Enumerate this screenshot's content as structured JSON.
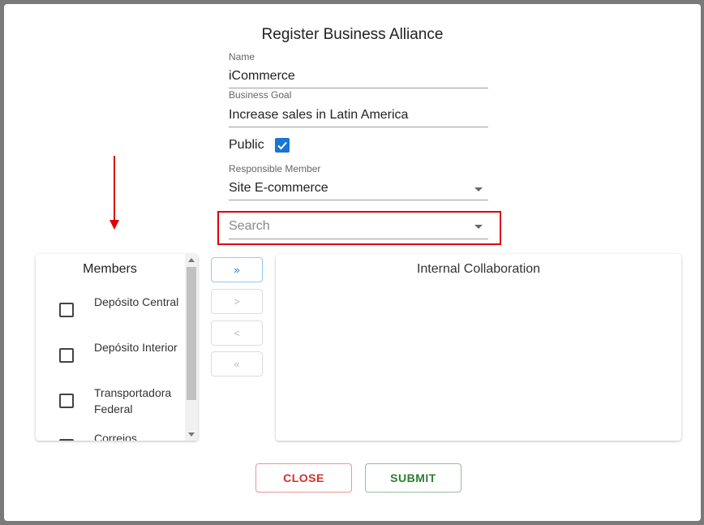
{
  "dialog": {
    "title": "Register Business Alliance"
  },
  "form": {
    "name_label": "Name",
    "name_value": "iCommerce",
    "goal_label": "Business Goal",
    "goal_value": "Increase sales in Latin America",
    "public_label": "Public",
    "public_checked": true,
    "responsible_label": "Responsible Member",
    "responsible_value": "Site E-commerce",
    "search_placeholder": "Search"
  },
  "members": {
    "title": "Members",
    "items": [
      {
        "label": "Depósito Central",
        "checked": false
      },
      {
        "label": "Depósito Interior",
        "checked": false
      },
      {
        "label": "Transportadora Federal",
        "checked": false
      },
      {
        "label": "Correios",
        "checked": false
      }
    ]
  },
  "transfer": {
    "move_all_right": "»",
    "move_right": ">",
    "move_left": "<",
    "move_all_left": "«"
  },
  "collaboration": {
    "title": "Internal Collaboration"
  },
  "actions": {
    "close_label": "CLOSE",
    "submit_label": "SUBMIT"
  },
  "colors": {
    "accent": "#1976d2",
    "annotation": "#e00000",
    "close": "#d32f2f",
    "submit": "#2e7d32"
  }
}
